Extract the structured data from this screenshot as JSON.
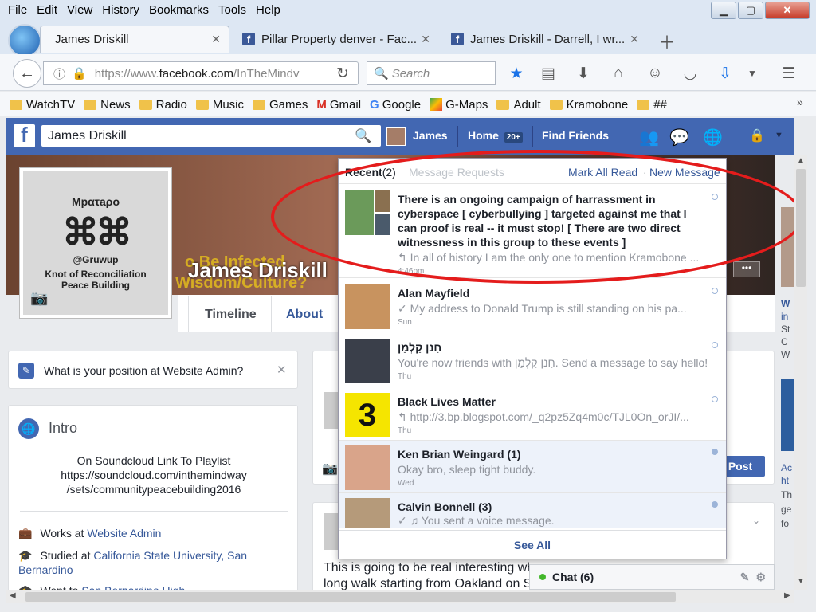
{
  "menu": [
    "File",
    "Edit",
    "View",
    "History",
    "Bookmarks",
    "Tools",
    "Help"
  ],
  "tabs": [
    {
      "label": "James Driskill"
    },
    {
      "label": "Pillar Property denver - Fac..."
    },
    {
      "label": "James Driskill - Darrell, I wr..."
    }
  ],
  "url": {
    "prefix": "https://www.",
    "domain": "facebook.com",
    "path": "/InTheMindv"
  },
  "search_placeholder": "Search",
  "bookmarks": [
    "WatchTV",
    "News",
    "Radio",
    "Music",
    "Games",
    "Gmail",
    "Google",
    "G-Maps",
    "Adult",
    "Kramobone",
    "##"
  ],
  "fb": {
    "search_value": "James Driskill",
    "user": "James",
    "home": "Home",
    "home_badge": "20+",
    "find_friends": "Find Friends"
  },
  "profile": {
    "name": "James Driskill",
    "cover_text_1": "o Be Infected",
    "cover_text_2": "Wisdom/Culture?",
    "pic_top": "Μpατaρo",
    "pic_side": "@Gruwup",
    "pic_bottom_1": "Knot of Reconciliation",
    "pic_bottom_2": "Peace Building"
  },
  "timeline_nav": [
    "Timeline",
    "About"
  ],
  "admin_prompt": "What is your position at Website Admin?",
  "intro": {
    "heading": "Intro",
    "bio_1": "On Soundcloud Link To Playlist",
    "bio_2": "https://soundcloud.com/inthemindway",
    "bio_3": "/sets/communitypeacebuilding2016",
    "works_prefix": "Works at ",
    "works_link": "Website Admin",
    "studied_prefix": "Studied at ",
    "studied_link": "California State University, San Bernardino",
    "went_prefix": "Went to ",
    "went_link": "San Bernardino High"
  },
  "post_button": "Post",
  "post_text_1": "This is going to be real interesting whe",
  "post_text_2": "long walk starting from Oakland on Se",
  "messages": {
    "recent_label": "Recent",
    "recent_count": "(2)",
    "requests_label": "Message Requests",
    "mark_all": "Mark All Read",
    "new_message": "New Message",
    "see_all": "See All",
    "items": [
      {
        "title": "There is an ongoing campaign of harrassment in cyberspace [ cyberbullying ] targeted against me that I can proof is real -- it must stop! [ There are two direct witnessness in this group to these events ]",
        "snippet": "In all of history I am the only one to mention Kramobone ...",
        "time": "4:46pm"
      },
      {
        "title": "Alan Mayfield",
        "snippet": "My address to Donald Trump is still standing on his pa...",
        "time": "Sun"
      },
      {
        "title": "חַנן קַלְמַן",
        "snippet": "You're now friends with חַנן קַלְמַן. Send a message to say hello!",
        "time": "Thu"
      },
      {
        "title": "Black Lives Matter",
        "snippet": "http://3.bp.blogspot.com/_q2pz5Zq4m0c/TJL0On_orJI/...",
        "time": "Thu"
      },
      {
        "title": "Ken Brian Weingard (1)",
        "snippet": "Okay bro, sleep tight buddy.",
        "time": "Wed"
      },
      {
        "title": "Calvin Bonnell (3)",
        "snippet": "You sent a voice message.",
        "time": ""
      }
    ]
  },
  "chat_label": "Chat (6)",
  "right_col": [
    "W",
    "in",
    "St",
    "C",
    "W",
    "Ac",
    "ht",
    "Th",
    "ge",
    "fo"
  ]
}
